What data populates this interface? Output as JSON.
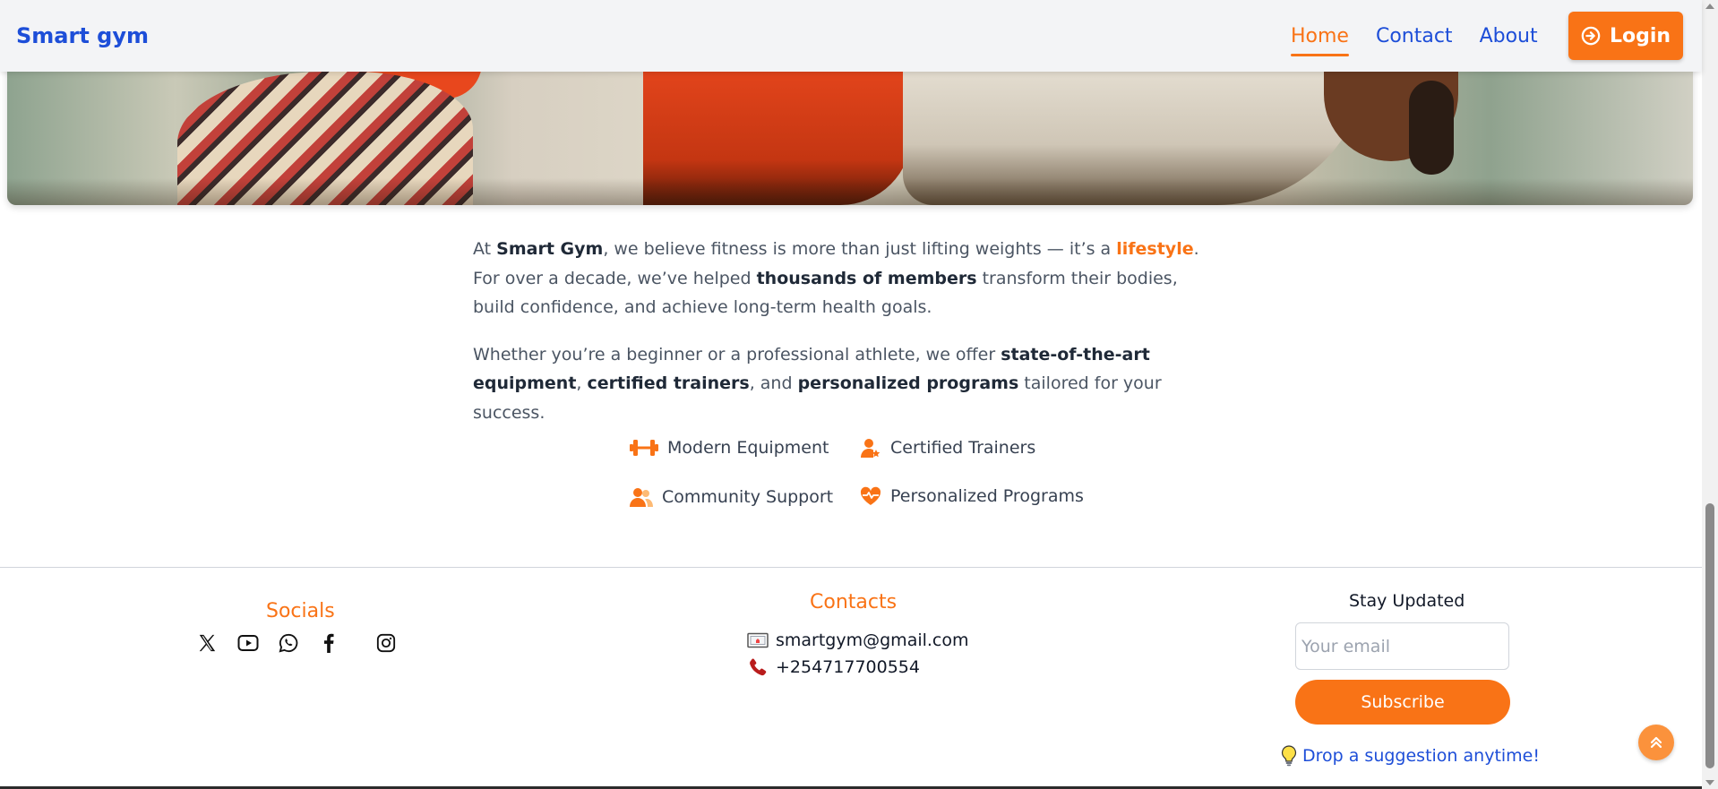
{
  "brand": "Smart gym",
  "nav": {
    "links": [
      "Home",
      "Contact",
      "About"
    ],
    "active": "Home",
    "login_label": "Login"
  },
  "about": {
    "p1": {
      "pre": "At ",
      "brand": "Smart Gym",
      "mid1": ", we believe fitness is more than just lifting weights — it’s a ",
      "highlight": "lifestyle",
      "mid2": ". For over a decade, we’ve helped ",
      "bold1": "thousands of members",
      "post": " transform their bodies, build confidence, and achieve long-term health goals."
    },
    "p2": {
      "pre": "Whether you’re a beginner or a professional athlete, we offer ",
      "bold1": "state-of-the-art equipment",
      "sep1": ", ",
      "bold2": "certified trainers",
      "sep2": ", and ",
      "bold3": "personalized programs",
      "post": " tailored for your success."
    }
  },
  "features": [
    {
      "label": "Modern Equipment",
      "icon": "dumbbell-icon"
    },
    {
      "label": "Certified Trainers",
      "icon": "user-star-icon"
    },
    {
      "label": "Community Support",
      "icon": "users-icon"
    },
    {
      "label": "Personalized Programs",
      "icon": "heart-pulse-icon"
    }
  ],
  "footer": {
    "socials_title": "Socials",
    "socials": [
      "x-icon",
      "youtube-icon",
      "whatsapp-icon",
      "facebook-icon",
      "instagram-icon"
    ],
    "contacts_title": "Contacts",
    "email": "smartgym@gmail.com",
    "phone": "+254717700554",
    "stay_title": "Stay Updated",
    "email_placeholder": "Your email",
    "subscribe_label": "Subscribe",
    "suggestion": "Drop a suggestion anytime!"
  },
  "colors": {
    "accent": "#f97316",
    "brand_blue": "#1d4ed8"
  }
}
